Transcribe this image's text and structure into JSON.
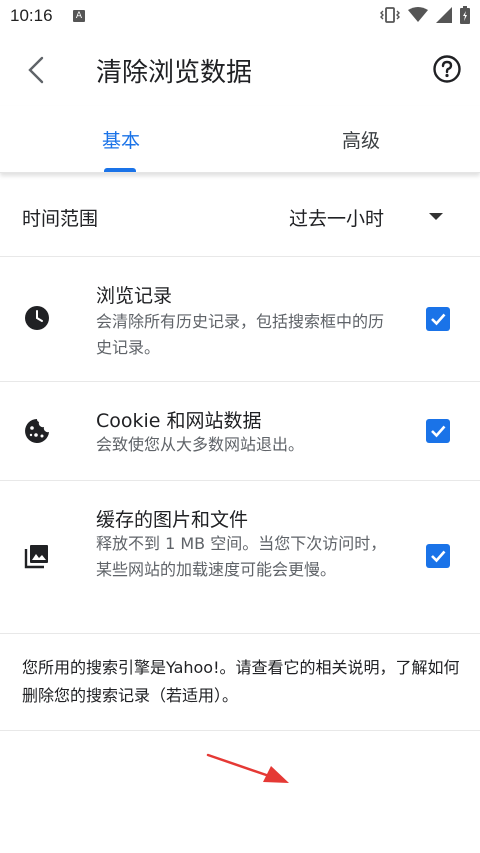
{
  "status_bar": {
    "time": "10:16",
    "notif_letter": "A"
  },
  "app_bar": {
    "title": "清除浏览数据"
  },
  "tabs": [
    {
      "label": "基本",
      "selected": true
    },
    {
      "label": "高级",
      "selected": false
    }
  ],
  "time_range": {
    "label": "时间范围",
    "value": "过去一小时"
  },
  "items": [
    {
      "title": "浏览记录",
      "subtitle": "会清除所有历史记录，包括搜索框中的历史记录。",
      "checked": true,
      "icon": "clock-icon"
    },
    {
      "title": "Cookie 和网站数据",
      "subtitle": "会致使您从大多数网站退出。",
      "checked": true,
      "icon": "cookie-icon"
    },
    {
      "title": "缓存的图片和文件",
      "subtitle": "释放不到 1 MB 空间。当您下次访问时，某些网站的加载速度可能会更慢。",
      "checked": true,
      "icon": "image-library-icon"
    }
  ],
  "note": "您所用的搜索引擎是Yahoo!。请查看它的相关说明，了解如何删除您的搜索记录（若适用）。",
  "colors": {
    "accent": "#1a73e8",
    "arrow": "#e53935"
  }
}
